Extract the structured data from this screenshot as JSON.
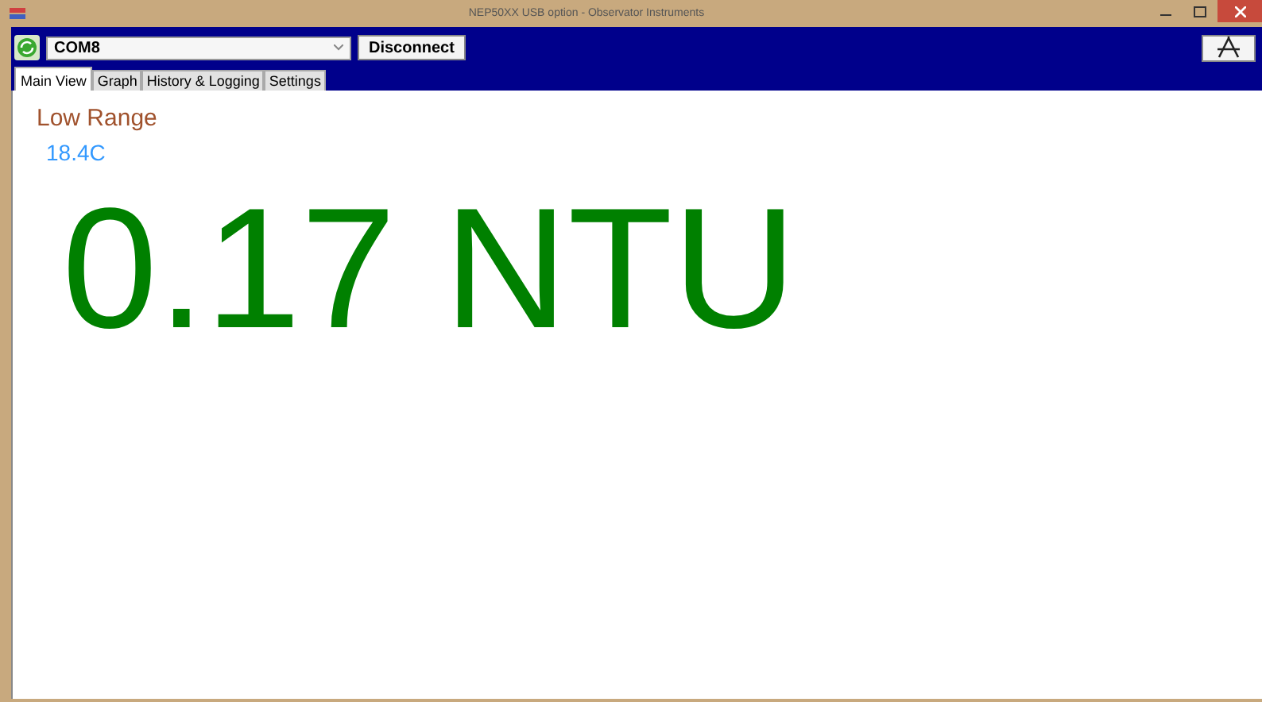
{
  "window": {
    "title": "NEP50XX USB option - Observator Instruments"
  },
  "toolbar": {
    "port": "COM8",
    "connect_button": "Disconnect"
  },
  "tabs": [
    {
      "label": "Main View",
      "selected": true
    },
    {
      "label": "Graph",
      "selected": false
    },
    {
      "label": "History & Logging",
      "selected": false
    },
    {
      "label": "Settings",
      "selected": false
    }
  ],
  "main": {
    "range": "Low Range",
    "temperature": "18.4C",
    "reading": "0.17 NTU"
  }
}
